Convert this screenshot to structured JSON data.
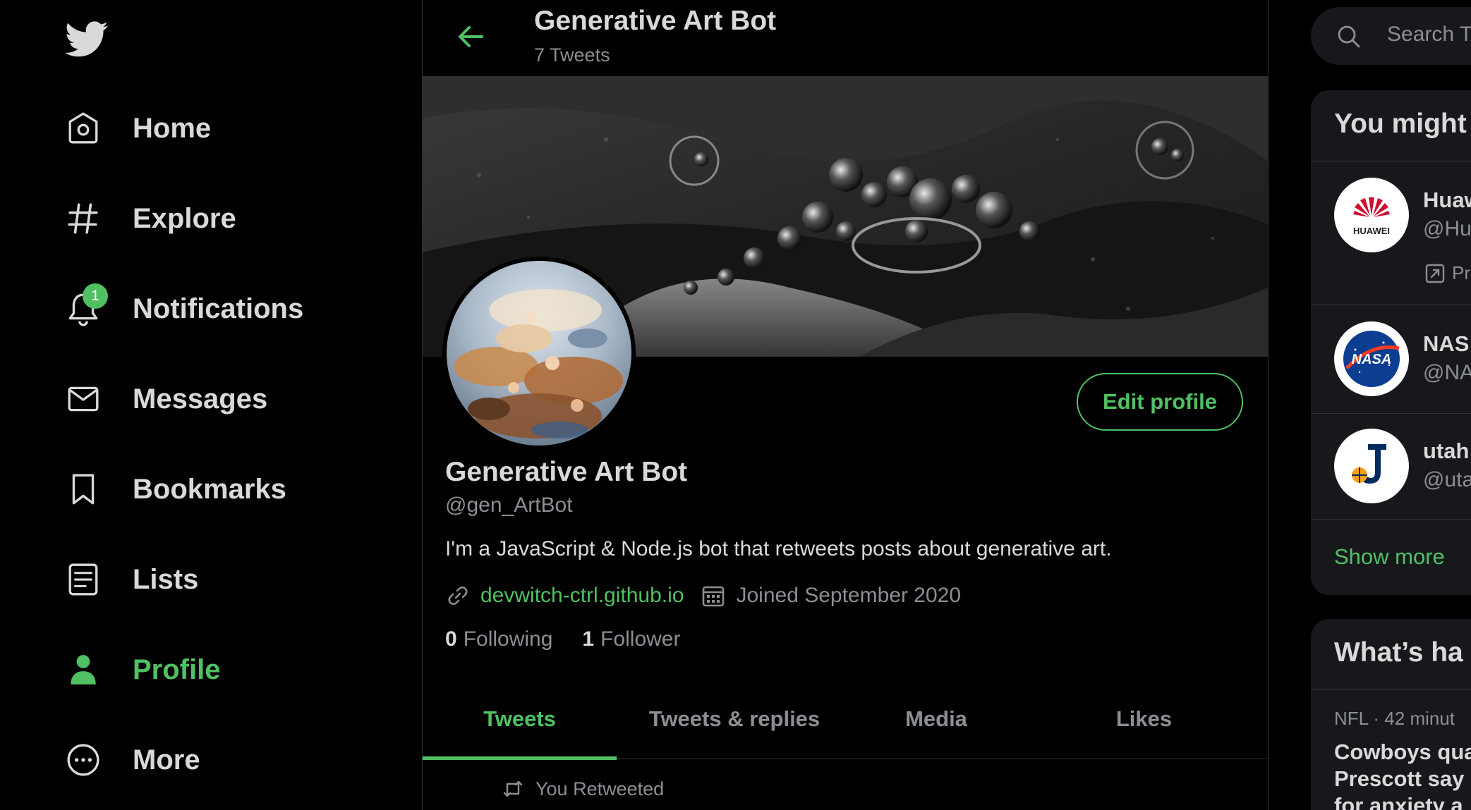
{
  "colors": {
    "accent": "#4fc163",
    "background": "#000000",
    "panel": "#16181c",
    "muted": "#8b8f94",
    "text": "#d9d9d9",
    "border": "#2f3336"
  },
  "sidebar": {
    "logo_icon": "twitter-bird-icon",
    "items": [
      {
        "label": "Home",
        "icon": "home-icon",
        "active": false
      },
      {
        "label": "Explore",
        "icon": "hashtag-icon",
        "active": false
      },
      {
        "label": "Notifications",
        "icon": "bell-icon",
        "active": false,
        "badge": "1"
      },
      {
        "label": "Messages",
        "icon": "envelope-icon",
        "active": false
      },
      {
        "label": "Bookmarks",
        "icon": "bookmark-icon",
        "active": false
      },
      {
        "label": "Lists",
        "icon": "list-icon",
        "active": false
      },
      {
        "label": "Profile",
        "icon": "person-icon",
        "active": true
      },
      {
        "label": "More",
        "icon": "more-circle-icon",
        "active": false
      }
    ]
  },
  "header": {
    "title": "Generative Art Bot",
    "subtitle": "7 Tweets"
  },
  "profile": {
    "name": "Generative Art Bot",
    "handle": "@gen_ArtBot",
    "bio": "I'm a JavaScript & Node.js bot that retweets posts about generative art.",
    "website": "devwitch-ctrl.github.io",
    "joined": "Joined September 2020",
    "following_count": "0",
    "following_label": "Following",
    "followers_count": "1",
    "followers_label": "Follower",
    "edit_label": "Edit profile"
  },
  "tabs": [
    {
      "label": "Tweets",
      "active": true
    },
    {
      "label": "Tweets & replies",
      "active": false
    },
    {
      "label": "Media",
      "active": false
    },
    {
      "label": "Likes",
      "active": false
    }
  ],
  "timeline": {
    "retweet_label": "You Retweeted"
  },
  "right": {
    "search_placeholder": "Search T",
    "suggest_title": "You might",
    "suggestions": [
      {
        "name": "Huaw",
        "handle": "@Hu",
        "promoted": "Pr"
      },
      {
        "name": "NAS",
        "handle": "@NA"
      },
      {
        "name": "utah",
        "handle": "@uta"
      }
    ],
    "show_more": "Show more",
    "trends_title": "What’s ha",
    "trend": {
      "category": "NFL",
      "separator": "·",
      "time": "42 minut",
      "line1": "Cowboys qua",
      "line2": "Prescott say",
      "line3": "for anxiety a"
    }
  }
}
